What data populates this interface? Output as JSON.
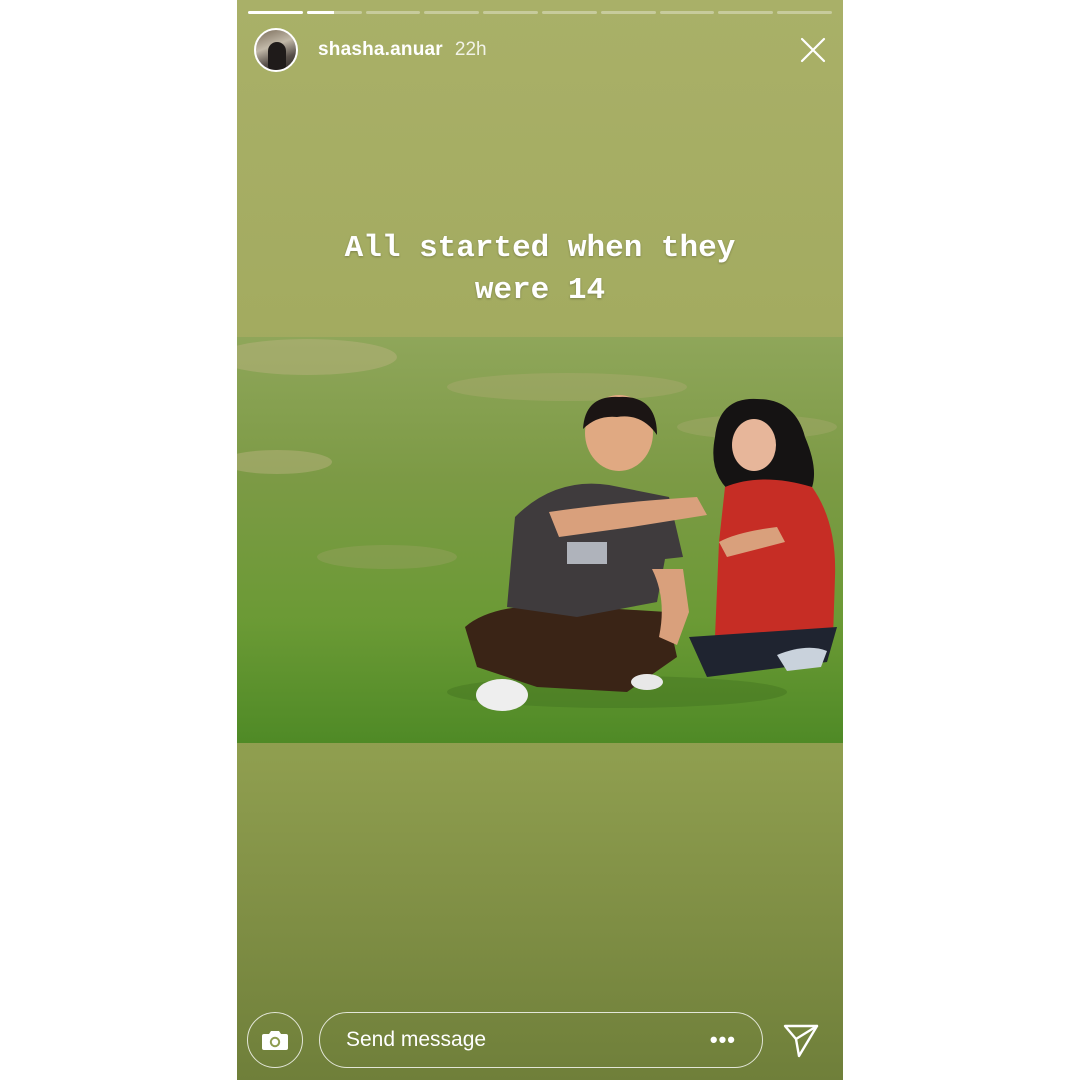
{
  "story": {
    "username": "shasha.anuar",
    "time": "22h",
    "progress_segments": [
      1,
      0.5,
      0,
      0,
      0,
      0,
      0,
      0,
      0,
      0
    ],
    "caption_lines": [
      "All started when they",
      "were 14"
    ]
  },
  "footer": {
    "message_placeholder": "Send message",
    "more_label": "•••"
  },
  "icons": {
    "close": "close-icon",
    "camera": "camera-icon",
    "send": "send-icon"
  },
  "colors": {
    "background_top": "#a9b068",
    "background_bottom": "#6f7f3a",
    "text": "#ffffff"
  }
}
